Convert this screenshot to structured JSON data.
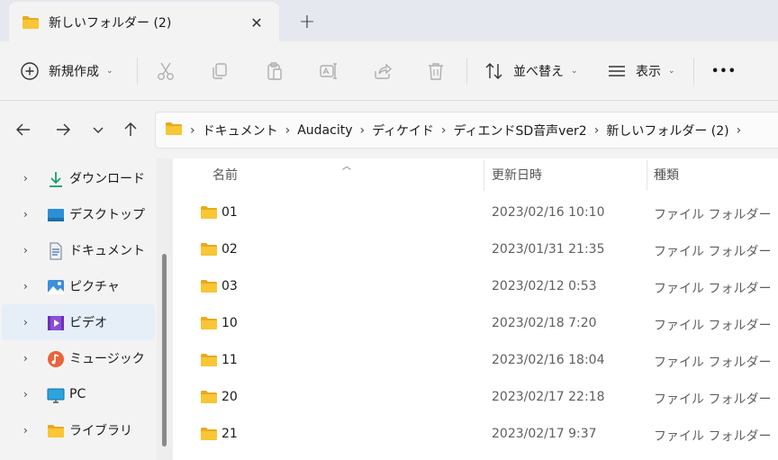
{
  "tab": {
    "title": "新しいフォルダー (2)",
    "close_glyph": "✕",
    "new_tab_glyph": "+"
  },
  "toolbar": {
    "new_label": "新規作成",
    "sort_label": "並べ替え",
    "view_label": "表示",
    "more_glyph": "•••"
  },
  "breadcrumbs": [
    "ドキュメント",
    "Audacity",
    "ディケイド",
    "ディエンドSD音声ver2",
    "新しいフォルダー (2)"
  ],
  "sidebar": {
    "items": [
      {
        "label": "ダウンロード",
        "icon": "download-icon"
      },
      {
        "label": "デスクトップ",
        "icon": "desktop-icon"
      },
      {
        "label": "ドキュメント",
        "icon": "document-icon"
      },
      {
        "label": "ピクチャ",
        "icon": "pictures-icon"
      },
      {
        "label": "ビデオ",
        "icon": "video-icon"
      },
      {
        "label": "ミュージック",
        "icon": "music-icon"
      },
      {
        "label": "PC",
        "icon": "pc-icon"
      },
      {
        "label": "ライブラリ",
        "icon": "library-icon"
      }
    ]
  },
  "columns": {
    "name": "名前",
    "date": "更新日時",
    "type": "種類"
  },
  "files": [
    {
      "name": "01",
      "date": "2023/02/16 10:10",
      "type": "ファイル フォルダー"
    },
    {
      "name": "02",
      "date": "2023/01/31 21:35",
      "type": "ファイル フォルダー"
    },
    {
      "name": "03",
      "date": "2023/02/12 0:53",
      "type": "ファイル フォルダー"
    },
    {
      "name": "10",
      "date": "2023/02/18 7:20",
      "type": "ファイル フォルダー"
    },
    {
      "name": "11",
      "date": "2023/02/16 18:04",
      "type": "ファイル フォルダー"
    },
    {
      "name": "20",
      "date": "2023/02/17 22:18",
      "type": "ファイル フォルダー"
    },
    {
      "name": "21",
      "date": "2023/02/17 9:37",
      "type": "ファイル フォルダー"
    }
  ],
  "colors": {
    "folder": "#f8c636",
    "folder_dark": "#e9a91e",
    "accent": "#0067c0",
    "selected_bg": "#e6eef8"
  }
}
